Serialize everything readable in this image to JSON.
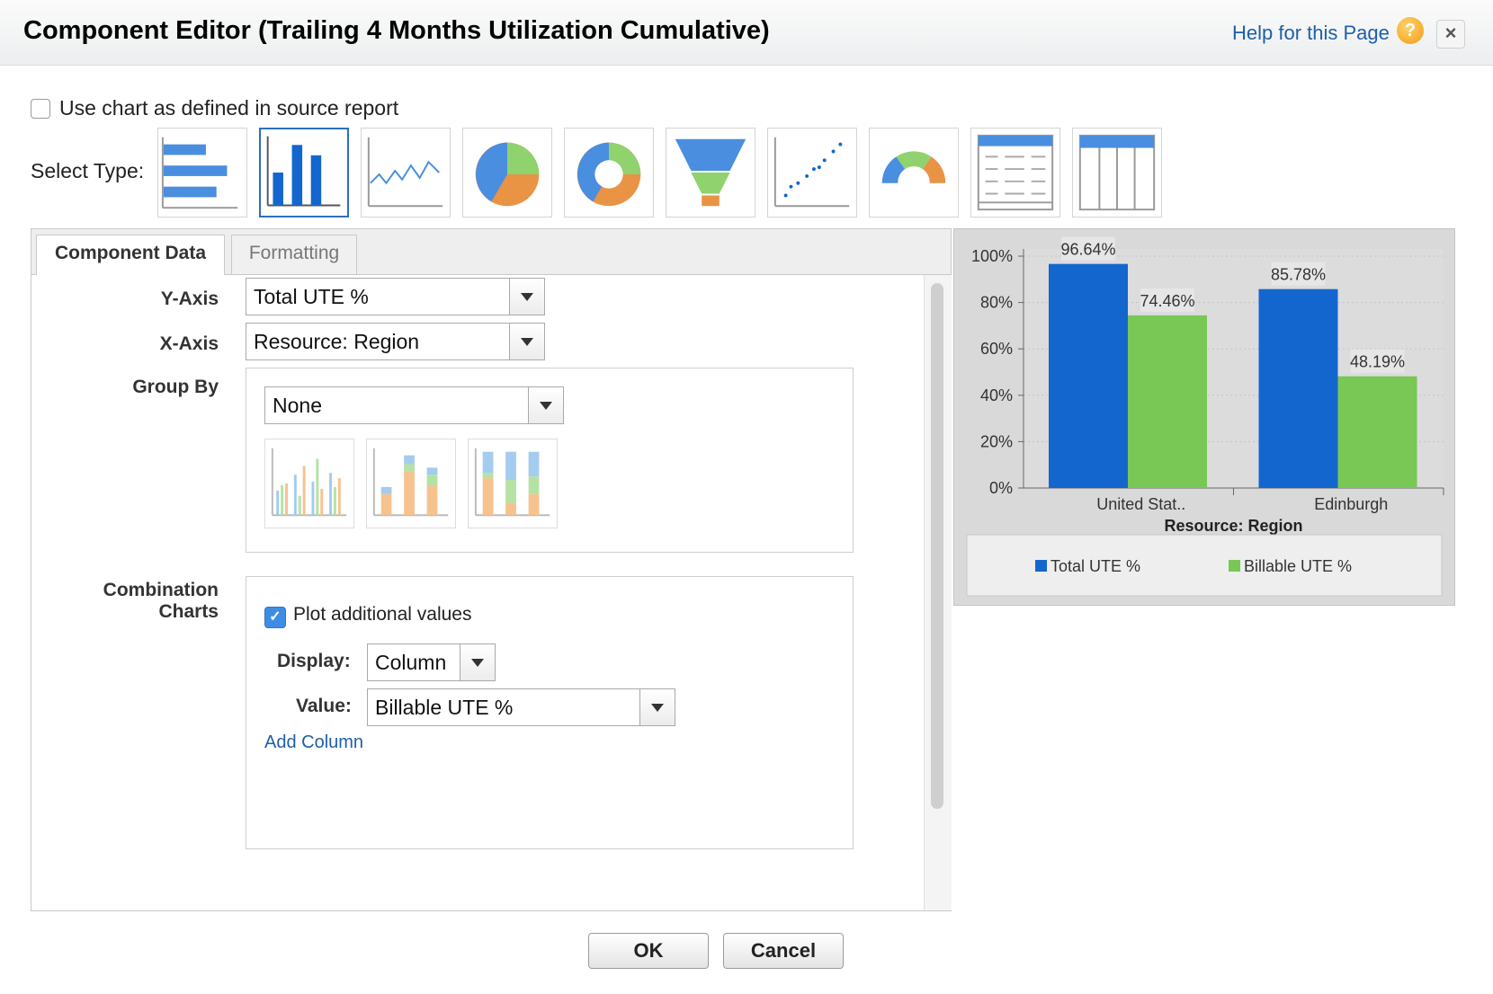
{
  "header": {
    "title": "Component Editor (Trailing 4 Months Utilization Cumulative)",
    "help_link": "Help for this Page",
    "help_icon": "help-icon",
    "close_icon": "close-icon"
  },
  "source_option": {
    "label": "Use chart as defined in source report",
    "checked": false
  },
  "select_type": {
    "label": "Select Type:",
    "types": [
      "horizontal-bar-chart-icon",
      "vertical-bar-chart-icon",
      "line-chart-icon",
      "pie-chart-icon",
      "donut-chart-icon",
      "funnel-chart-icon",
      "scatter-chart-icon",
      "gauge-chart-icon",
      "table-icon",
      "metric-grid-icon"
    ],
    "selected": "vertical-bar-chart-icon"
  },
  "tabs": [
    {
      "label": "Component Data",
      "active": true
    },
    {
      "label": "Formatting",
      "active": false
    }
  ],
  "form": {
    "y_axis": {
      "label": "Y-Axis",
      "value": "Total UTE %"
    },
    "x_axis": {
      "label": "X-Axis",
      "value": "Resource: Region"
    },
    "group_by": {
      "label": "Group By",
      "value": "None",
      "styles": [
        "side-by-side-icon",
        "stacked-icon",
        "stacked-100-icon"
      ]
    },
    "combination": {
      "label_line1": "Combination",
      "label_line2": "Charts",
      "plot_label": "Plot additional values",
      "plot_checked": true,
      "display_label": "Display:",
      "display_value": "Column",
      "value_label": "Value:",
      "value_value": "Billable UTE %",
      "add_column": "Add Column"
    }
  },
  "colors": {
    "total": "#1466cf",
    "billable": "#79c755",
    "link": "#1f5fa8"
  },
  "chart_data": {
    "type": "bar",
    "categories": [
      "United Stat..",
      "Edinburgh"
    ],
    "series": [
      {
        "name": "Total UTE %",
        "values": [
          96.64,
          85.78
        ],
        "labels": [
          "96.64%",
          "85.78%"
        ]
      },
      {
        "name": "Billable UTE %",
        "values": [
          74.46,
          48.19
        ],
        "labels": [
          "74.46%",
          "48.19%"
        ]
      }
    ],
    "ylim": [
      0,
      100
    ],
    "yticks": [
      "0%",
      "20%",
      "40%",
      "60%",
      "80%",
      "100%"
    ],
    "xlabel": "Resource: Region",
    "ylabel": "",
    "legend_position": "bottom"
  },
  "buttons": {
    "ok": "OK",
    "cancel": "Cancel"
  }
}
